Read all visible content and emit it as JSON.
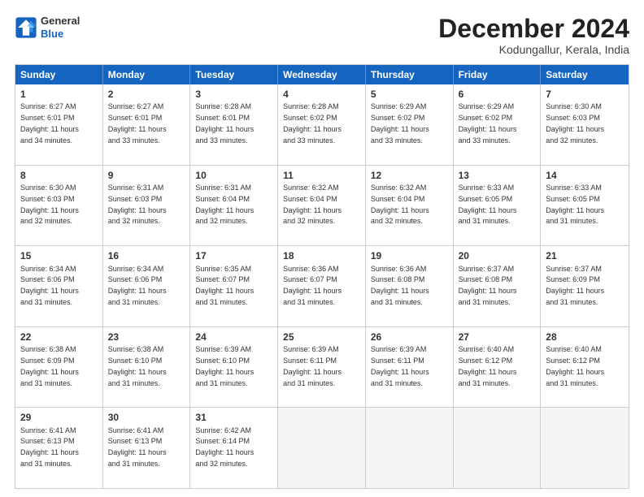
{
  "logo": {
    "general": "General",
    "blue": "Blue"
  },
  "title": "December 2024",
  "location": "Kodungallur, Kerala, India",
  "days_of_week": [
    "Sunday",
    "Monday",
    "Tuesday",
    "Wednesday",
    "Thursday",
    "Friday",
    "Saturday"
  ],
  "weeks": [
    [
      {
        "day": 1,
        "info": "Sunrise: 6:27 AM\nSunset: 6:01 PM\nDaylight: 11 hours\nand 34 minutes."
      },
      {
        "day": 2,
        "info": "Sunrise: 6:27 AM\nSunset: 6:01 PM\nDaylight: 11 hours\nand 33 minutes."
      },
      {
        "day": 3,
        "info": "Sunrise: 6:28 AM\nSunset: 6:01 PM\nDaylight: 11 hours\nand 33 minutes."
      },
      {
        "day": 4,
        "info": "Sunrise: 6:28 AM\nSunset: 6:02 PM\nDaylight: 11 hours\nand 33 minutes."
      },
      {
        "day": 5,
        "info": "Sunrise: 6:29 AM\nSunset: 6:02 PM\nDaylight: 11 hours\nand 33 minutes."
      },
      {
        "day": 6,
        "info": "Sunrise: 6:29 AM\nSunset: 6:02 PM\nDaylight: 11 hours\nand 33 minutes."
      },
      {
        "day": 7,
        "info": "Sunrise: 6:30 AM\nSunset: 6:03 PM\nDaylight: 11 hours\nand 32 minutes."
      }
    ],
    [
      {
        "day": 8,
        "info": "Sunrise: 6:30 AM\nSunset: 6:03 PM\nDaylight: 11 hours\nand 32 minutes."
      },
      {
        "day": 9,
        "info": "Sunrise: 6:31 AM\nSunset: 6:03 PM\nDaylight: 11 hours\nand 32 minutes."
      },
      {
        "day": 10,
        "info": "Sunrise: 6:31 AM\nSunset: 6:04 PM\nDaylight: 11 hours\nand 32 minutes."
      },
      {
        "day": 11,
        "info": "Sunrise: 6:32 AM\nSunset: 6:04 PM\nDaylight: 11 hours\nand 32 minutes."
      },
      {
        "day": 12,
        "info": "Sunrise: 6:32 AM\nSunset: 6:04 PM\nDaylight: 11 hours\nand 32 minutes."
      },
      {
        "day": 13,
        "info": "Sunrise: 6:33 AM\nSunset: 6:05 PM\nDaylight: 11 hours\nand 31 minutes."
      },
      {
        "day": 14,
        "info": "Sunrise: 6:33 AM\nSunset: 6:05 PM\nDaylight: 11 hours\nand 31 minutes."
      }
    ],
    [
      {
        "day": 15,
        "info": "Sunrise: 6:34 AM\nSunset: 6:06 PM\nDaylight: 11 hours\nand 31 minutes."
      },
      {
        "day": 16,
        "info": "Sunrise: 6:34 AM\nSunset: 6:06 PM\nDaylight: 11 hours\nand 31 minutes."
      },
      {
        "day": 17,
        "info": "Sunrise: 6:35 AM\nSunset: 6:07 PM\nDaylight: 11 hours\nand 31 minutes."
      },
      {
        "day": 18,
        "info": "Sunrise: 6:36 AM\nSunset: 6:07 PM\nDaylight: 11 hours\nand 31 minutes."
      },
      {
        "day": 19,
        "info": "Sunrise: 6:36 AM\nSunset: 6:08 PM\nDaylight: 11 hours\nand 31 minutes."
      },
      {
        "day": 20,
        "info": "Sunrise: 6:37 AM\nSunset: 6:08 PM\nDaylight: 11 hours\nand 31 minutes."
      },
      {
        "day": 21,
        "info": "Sunrise: 6:37 AM\nSunset: 6:09 PM\nDaylight: 11 hours\nand 31 minutes."
      }
    ],
    [
      {
        "day": 22,
        "info": "Sunrise: 6:38 AM\nSunset: 6:09 PM\nDaylight: 11 hours\nand 31 minutes."
      },
      {
        "day": 23,
        "info": "Sunrise: 6:38 AM\nSunset: 6:10 PM\nDaylight: 11 hours\nand 31 minutes."
      },
      {
        "day": 24,
        "info": "Sunrise: 6:39 AM\nSunset: 6:10 PM\nDaylight: 11 hours\nand 31 minutes."
      },
      {
        "day": 25,
        "info": "Sunrise: 6:39 AM\nSunset: 6:11 PM\nDaylight: 11 hours\nand 31 minutes."
      },
      {
        "day": 26,
        "info": "Sunrise: 6:39 AM\nSunset: 6:11 PM\nDaylight: 11 hours\nand 31 minutes."
      },
      {
        "day": 27,
        "info": "Sunrise: 6:40 AM\nSunset: 6:12 PM\nDaylight: 11 hours\nand 31 minutes."
      },
      {
        "day": 28,
        "info": "Sunrise: 6:40 AM\nSunset: 6:12 PM\nDaylight: 11 hours\nand 31 minutes."
      }
    ],
    [
      {
        "day": 29,
        "info": "Sunrise: 6:41 AM\nSunset: 6:13 PM\nDaylight: 11 hours\nand 31 minutes."
      },
      {
        "day": 30,
        "info": "Sunrise: 6:41 AM\nSunset: 6:13 PM\nDaylight: 11 hours\nand 31 minutes."
      },
      {
        "day": 31,
        "info": "Sunrise: 6:42 AM\nSunset: 6:14 PM\nDaylight: 11 hours\nand 32 minutes."
      },
      {
        "day": null,
        "info": ""
      },
      {
        "day": null,
        "info": ""
      },
      {
        "day": null,
        "info": ""
      },
      {
        "day": null,
        "info": ""
      }
    ]
  ]
}
